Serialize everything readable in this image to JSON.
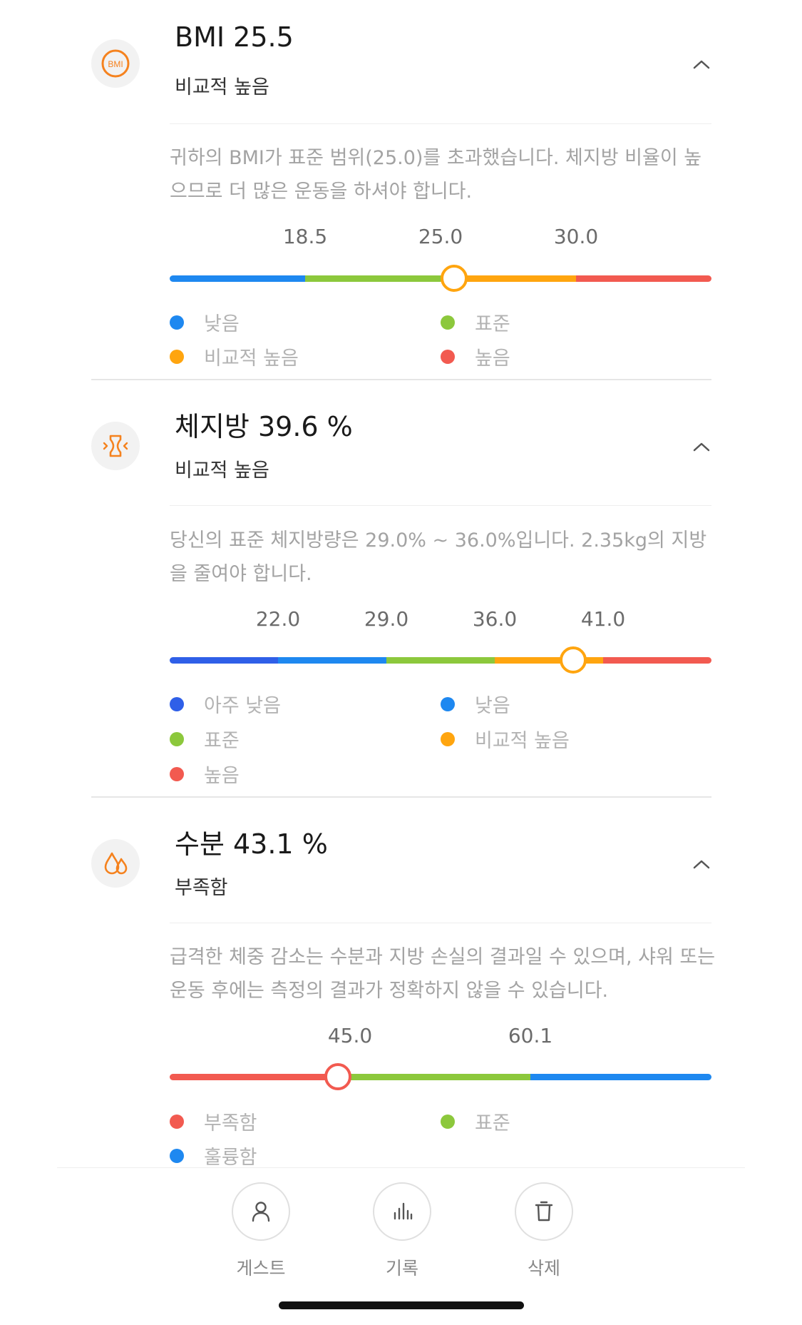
{
  "colors": {
    "very_low": "#2f5fe8",
    "low": "#1e88f0",
    "standard": "#8cc83c",
    "slightly_high": "#ffa50f",
    "high": "#f25a50",
    "icon_accent": "#f5821e"
  },
  "metrics": [
    {
      "icon": "bmi-icon",
      "icon_text": "BMI",
      "title": "BMI 25.5",
      "status": "비교적 높음",
      "description": "귀하의 BMI가 표준 범위(25.0)를 초과했습니다. 체지방 비율이 높으므로 더 많은 운동을 하셔야 합니다.",
      "ticks": [
        "18.5",
        "25.0",
        "30.0"
      ],
      "segments": [
        "low",
        "standard",
        "slightly_high",
        "high"
      ],
      "marker_fraction": 0.525,
      "marker_color": "slightly_high",
      "legend": [
        {
          "color": "low",
          "label": "낮음"
        },
        {
          "color": "standard",
          "label": "표준"
        },
        {
          "color": "slightly_high",
          "label": "비교적 높음"
        },
        {
          "color": "high",
          "label": "높음"
        }
      ]
    },
    {
      "icon": "body-fat-icon",
      "title": "체지방 39.6 %",
      "status": "비교적 높음",
      "description": "당신의 표준 체지방량은 29.0% ~ 36.0%입니다. 2.35kg의 지방을 줄여야 합니다.",
      "ticks": [
        "22.0",
        "29.0",
        "36.0",
        "41.0"
      ],
      "segments": [
        "very_low",
        "low",
        "standard",
        "slightly_high",
        "high"
      ],
      "marker_fraction": 0.745,
      "marker_color": "slightly_high",
      "legend": [
        {
          "color": "very_low",
          "label": "아주 낮음"
        },
        {
          "color": "low",
          "label": "낮음"
        },
        {
          "color": "standard",
          "label": "표준"
        },
        {
          "color": "slightly_high",
          "label": "비교적 높음"
        },
        {
          "color": "high",
          "label": "높음"
        }
      ]
    },
    {
      "icon": "water-drops-icon",
      "title": "수분 43.1 %",
      "status": "부족함",
      "description": "급격한 체중 감소는 수분과 지방 손실의 결과일 수 있으며, 샤워 또는 운동 후에는 측정의 결과가 정확하지 않을 수 있습니다.",
      "ticks": [
        "45.0",
        "60.1"
      ],
      "segments": [
        "high",
        "standard",
        "low"
      ],
      "marker_fraction": 0.31,
      "marker_color": "high",
      "legend": [
        {
          "color": "high",
          "label": "부족함"
        },
        {
          "color": "standard",
          "label": "표준"
        },
        {
          "color": "low",
          "label": "훌륭함"
        }
      ]
    }
  ],
  "actions": [
    {
      "icon": "person-icon",
      "label": "게스트"
    },
    {
      "icon": "bar-chart-icon",
      "label": "기록"
    },
    {
      "icon": "trash-icon",
      "label": "삭제"
    }
  ]
}
